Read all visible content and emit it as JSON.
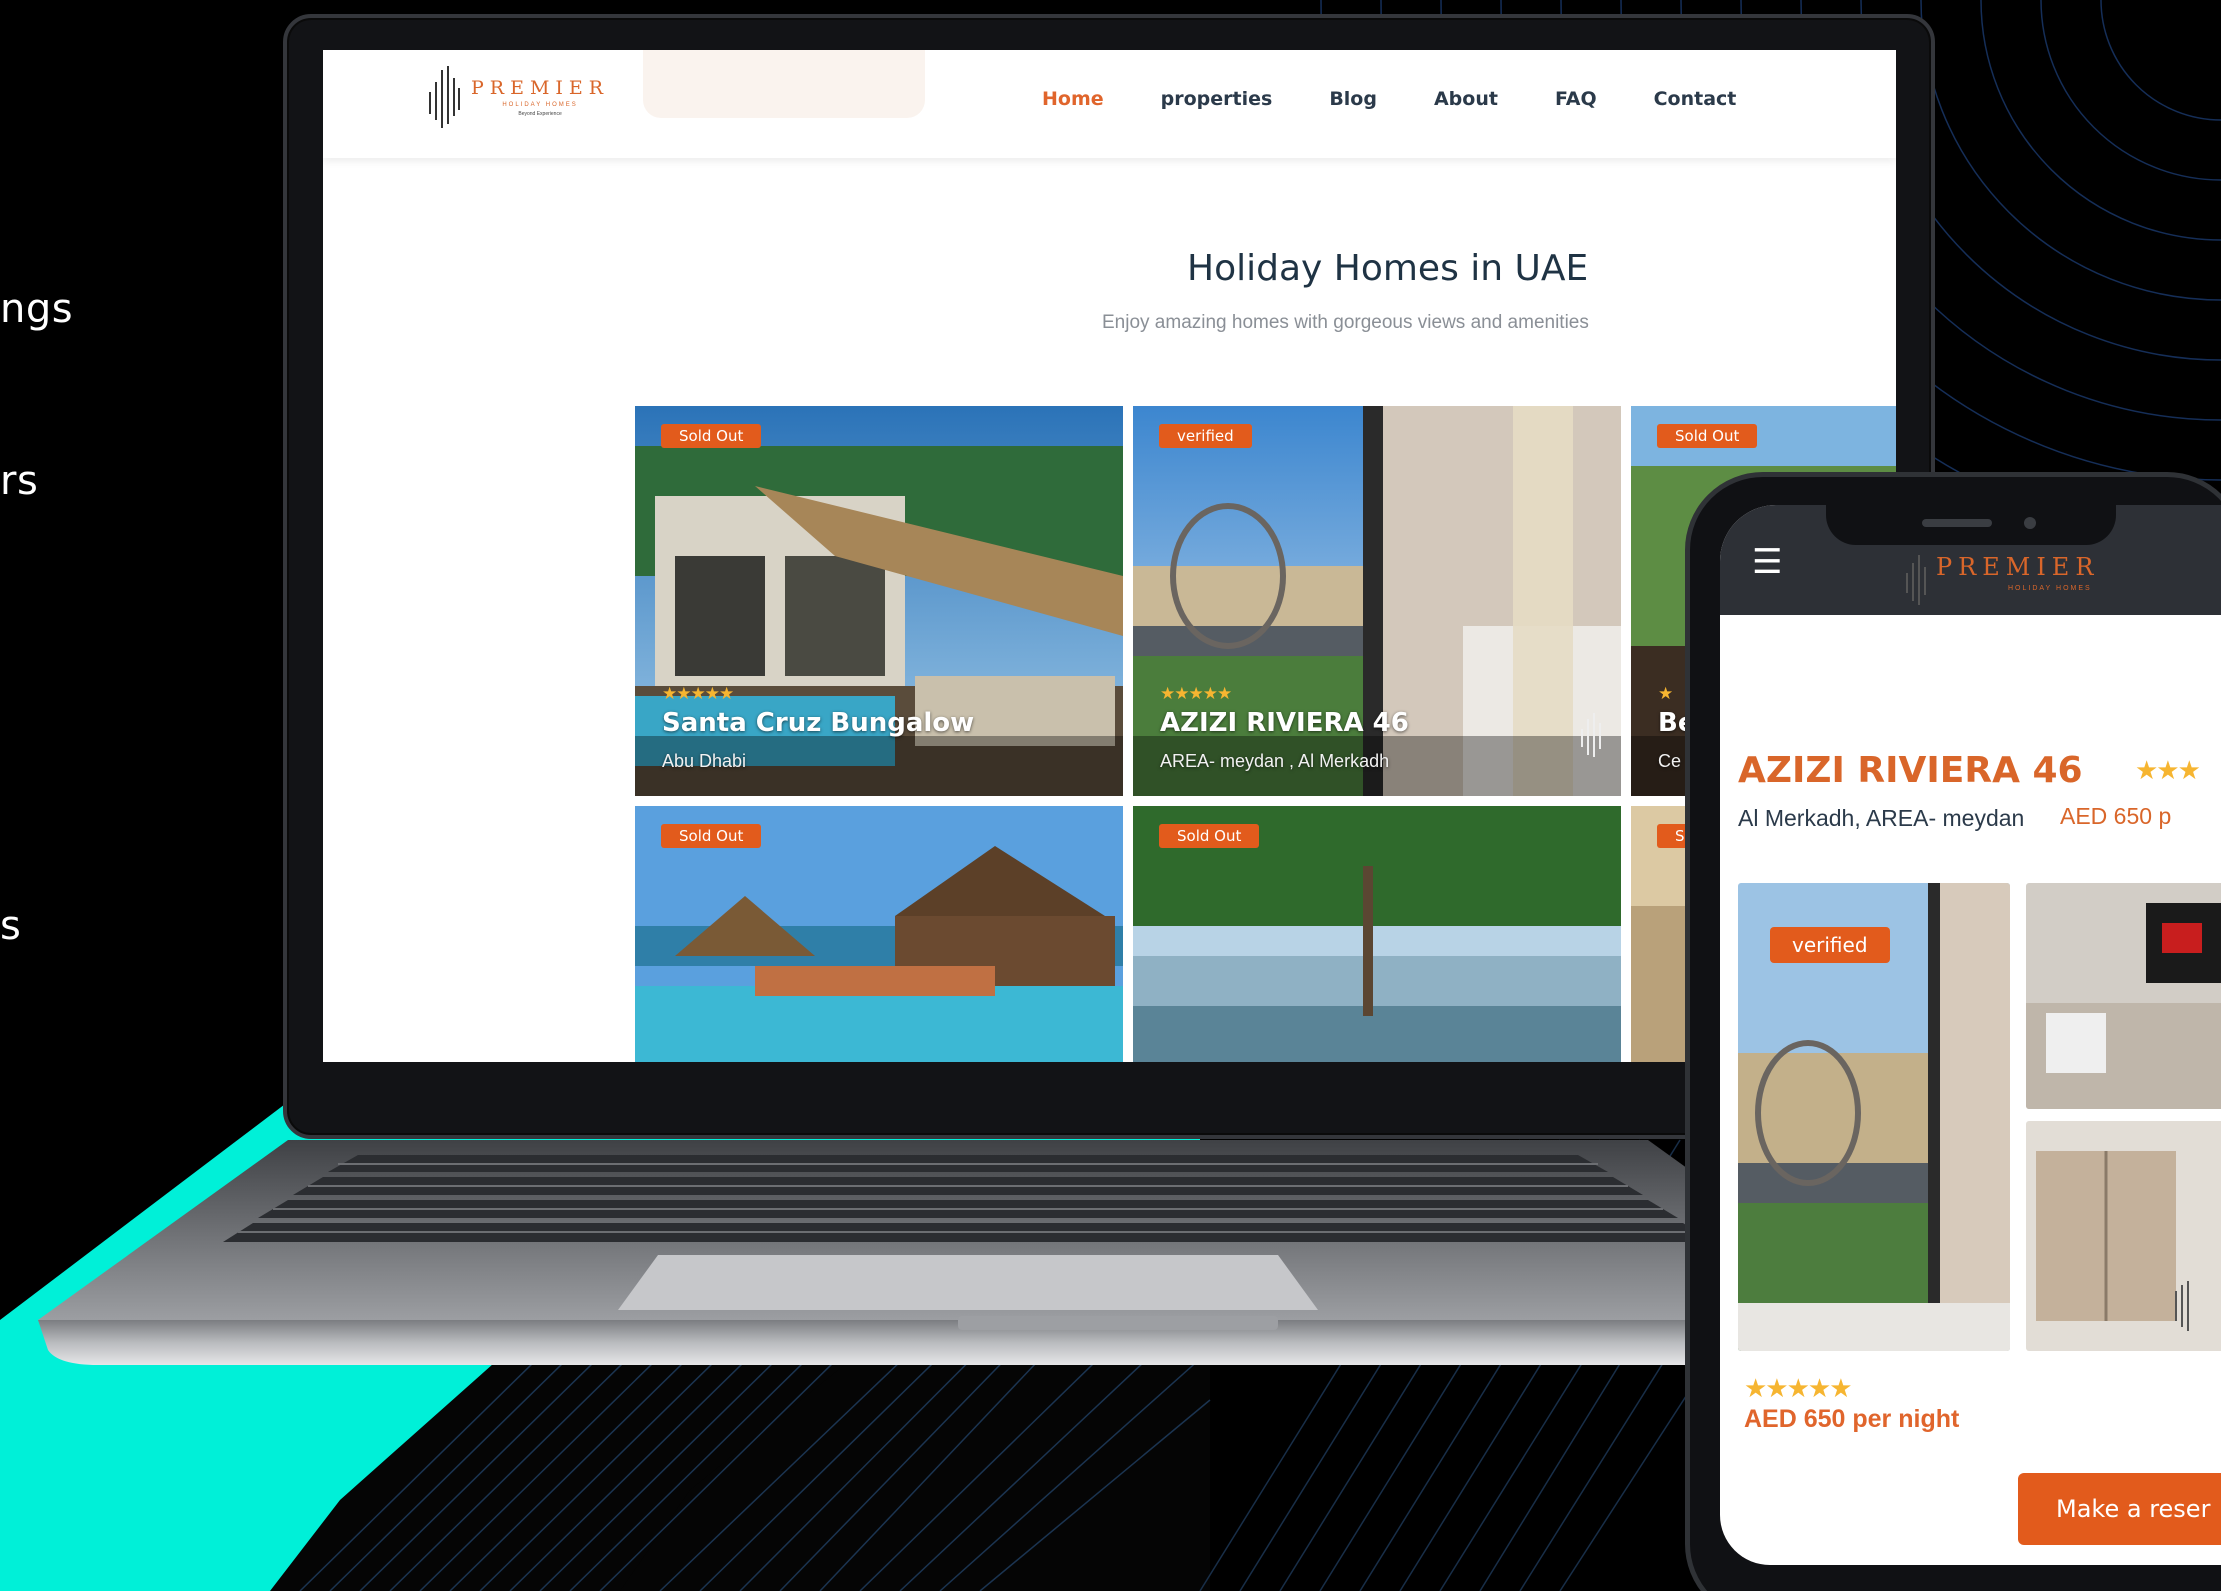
{
  "side_text": [
    "ngs",
    "rs",
    "s"
  ],
  "site": {
    "logo": {
      "word": "PREMIER",
      "sub": "HOLIDAY HOMES",
      "tag": "Beyond Experience"
    },
    "nav": [
      "Home",
      "properties",
      "Blog",
      "About",
      "FAQ",
      "Contact"
    ],
    "hero": {
      "title": "Holiday Homes in UAE",
      "subtitle": "Enjoy amazing homes with gorgeous views and amenities"
    },
    "cards": [
      {
        "badge": "Sold Out",
        "stars": "★★★★★",
        "title": "Santa Cruz Bungalow",
        "location": "Abu Dhabi"
      },
      {
        "badge": "verified",
        "stars": "★★★★★",
        "title": "AZIZI RIVIERA 46",
        "location": "AREA- meydan , Al Merkadh"
      },
      {
        "badge": "Sold Out",
        "stars": "★",
        "title": "Be",
        "location": "Ce"
      },
      {
        "badge": "Sold Out"
      },
      {
        "badge": "Sold Out"
      },
      {
        "badge": "S"
      }
    ]
  },
  "phone": {
    "logo": {
      "word": "PREMIER",
      "sub": "HOLIDAY HOMES"
    },
    "title": "AZIZI RIVIERA 46",
    "title_stars": "★★★",
    "subtitle": "Al Merkadh, AREA- meydan",
    "price_top": "AED 650 p",
    "badge": "verified",
    "stars": "★★★★★",
    "price": "AED 650 per night",
    "cta": "Make a reser"
  },
  "colors": {
    "accent": "#e25b1c",
    "brand": "#d9662a",
    "teal": "#00f0d8",
    "star": "#f6b531"
  },
  "icons": {
    "menu": "hamburger-icon",
    "logo": "premier-logo-icon"
  }
}
